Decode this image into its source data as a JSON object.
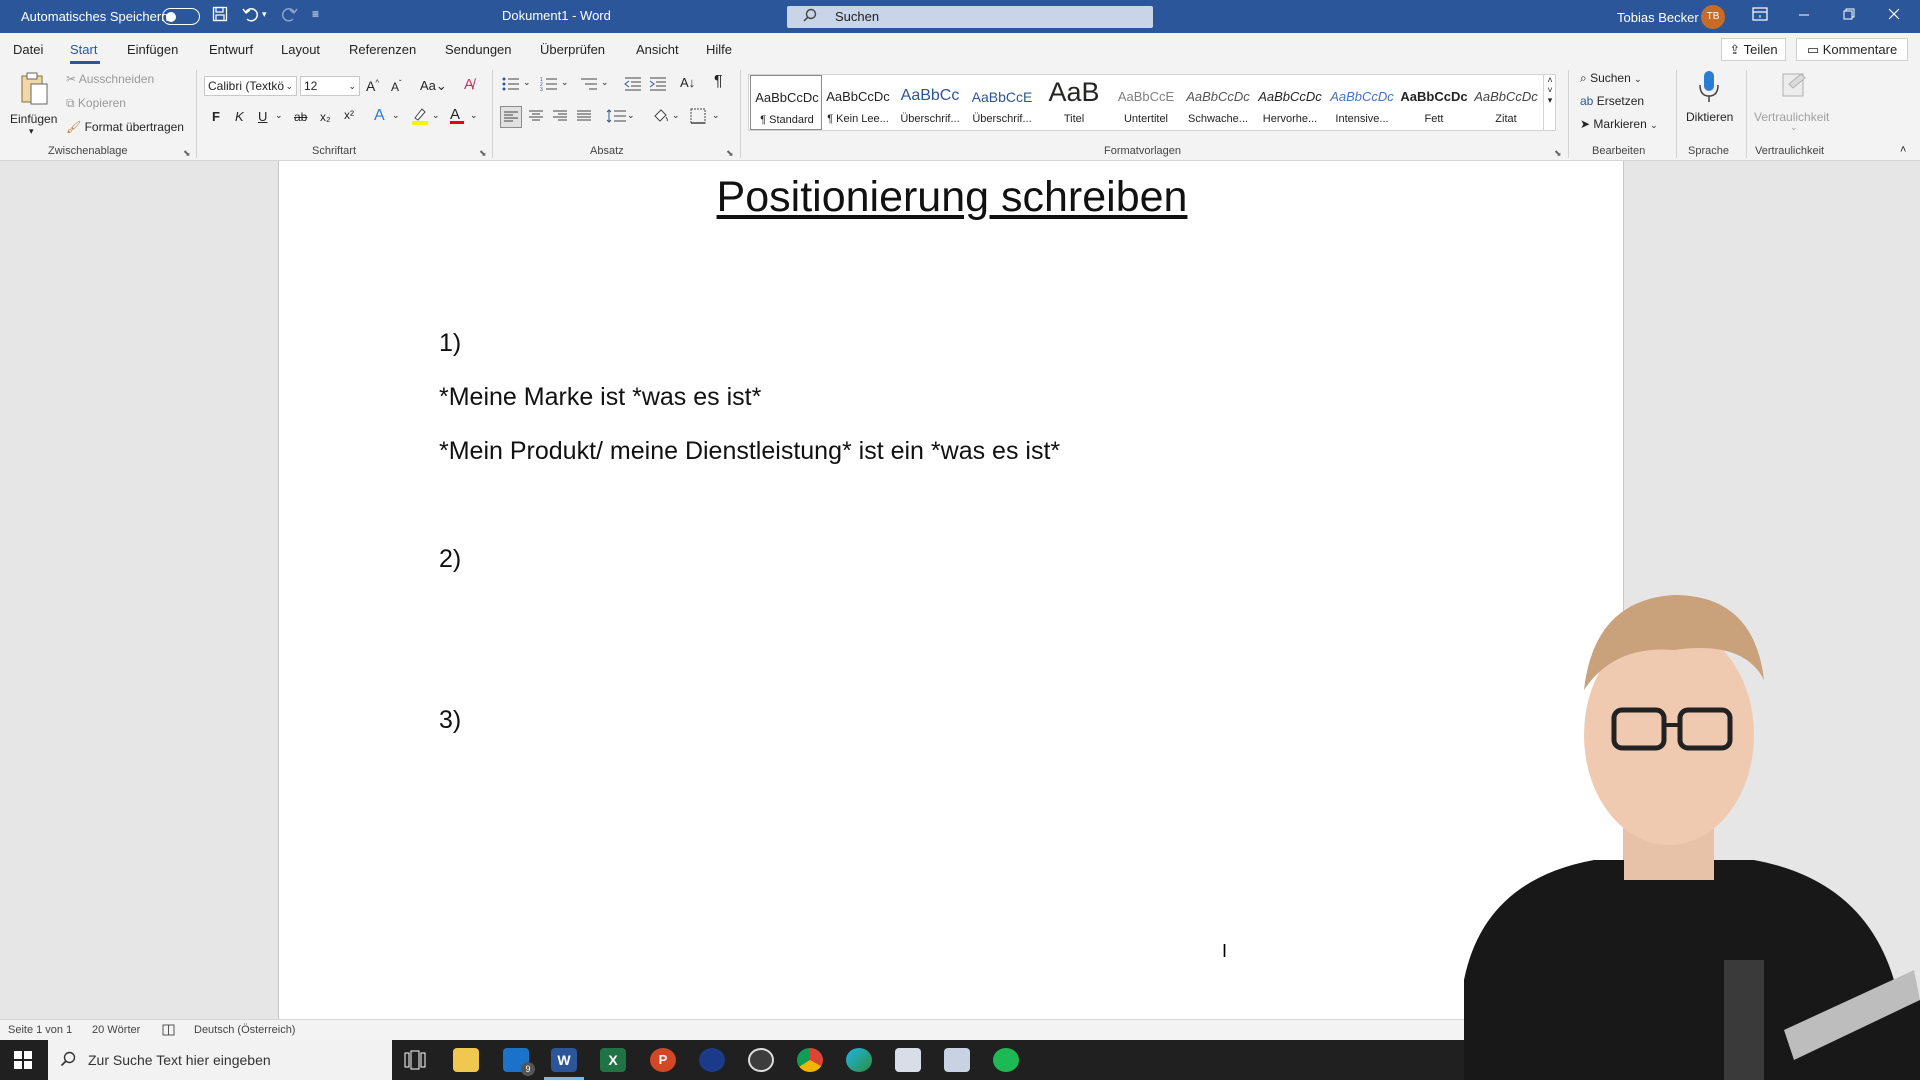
{
  "titlebar": {
    "autosave_label": "Automatisches Speichern",
    "doc_title": "Dokument1  -  Word",
    "search_placeholder": "Suchen",
    "user_name": "Tobias Becker",
    "user_initials": "TB"
  },
  "tabs": [
    "Datei",
    "Start",
    "Einfügen",
    "Entwurf",
    "Layout",
    "Referenzen",
    "Sendungen",
    "Überprüfen",
    "Ansicht",
    "Hilfe"
  ],
  "active_tab": "Start",
  "share_label": "Teilen",
  "comments_label": "Kommentare",
  "ribbon": {
    "clipboard": {
      "paste": "Einfügen",
      "cut": "Ausschneiden",
      "copy": "Kopieren",
      "format_painter": "Format übertragen",
      "group": "Zwischenablage"
    },
    "font": {
      "name": "Calibri (Textkö",
      "size": "12",
      "group": "Schriftart",
      "case_label": "Aa",
      "bold": "F",
      "italic": "K",
      "underline": "U",
      "strike": "ab",
      "sub": "x₂",
      "sup": "x²"
    },
    "paragraph": {
      "group": "Absatz"
    },
    "styles": {
      "group": "Formatvorlagen",
      "items": [
        {
          "preview": "AaBbCcDc",
          "name": "¶ Standard"
        },
        {
          "preview": "AaBbCcDc",
          "name": "¶ Kein Lee..."
        },
        {
          "preview": "AaBbCc",
          "name": "Überschrif..."
        },
        {
          "preview": "AaBbCcE",
          "name": "Überschrif..."
        },
        {
          "preview": "AaB",
          "name": "Titel"
        },
        {
          "preview": "AaBbCcE",
          "name": "Untertitel"
        },
        {
          "preview": "AaBbCcDc",
          "name": "Schwache..."
        },
        {
          "preview": "AaBbCcDc",
          "name": "Hervorhe..."
        },
        {
          "preview": "AaBbCcDc",
          "name": "Intensive..."
        },
        {
          "preview": "AaBbCcDc",
          "name": "Fett"
        },
        {
          "preview": "AaBbCcDc",
          "name": "Zitat"
        }
      ]
    },
    "editing": {
      "find": "Suchen",
      "replace": "Ersetzen",
      "select": "Markieren",
      "group": "Bearbeiten"
    },
    "voice": {
      "dictate": "Diktieren",
      "group": "Sprache"
    },
    "sensitivity": {
      "label": "Vertraulichkeit",
      "group": "Vertraulichkeit"
    }
  },
  "document": {
    "heading": "Positionierung schreiben",
    "lines": [
      "1)",
      "*Meine Marke ist *was es ist*",
      "*Mein Produkt/ meine Dienstleistung* ist ein *was es ist*",
      "2)",
      "3)"
    ]
  },
  "statusbar": {
    "page": "Seite 1 von 1",
    "words": "20 Wörter",
    "language": "Deutsch (Österreich)"
  },
  "taskbar": {
    "search_placeholder": "Zur Suche Text hier eingeben",
    "mail_badge": "9"
  },
  "colors": {
    "word_blue": "#2b579a",
    "ribbon_bg": "#f3f3f3",
    "taskbar": "#202020"
  }
}
